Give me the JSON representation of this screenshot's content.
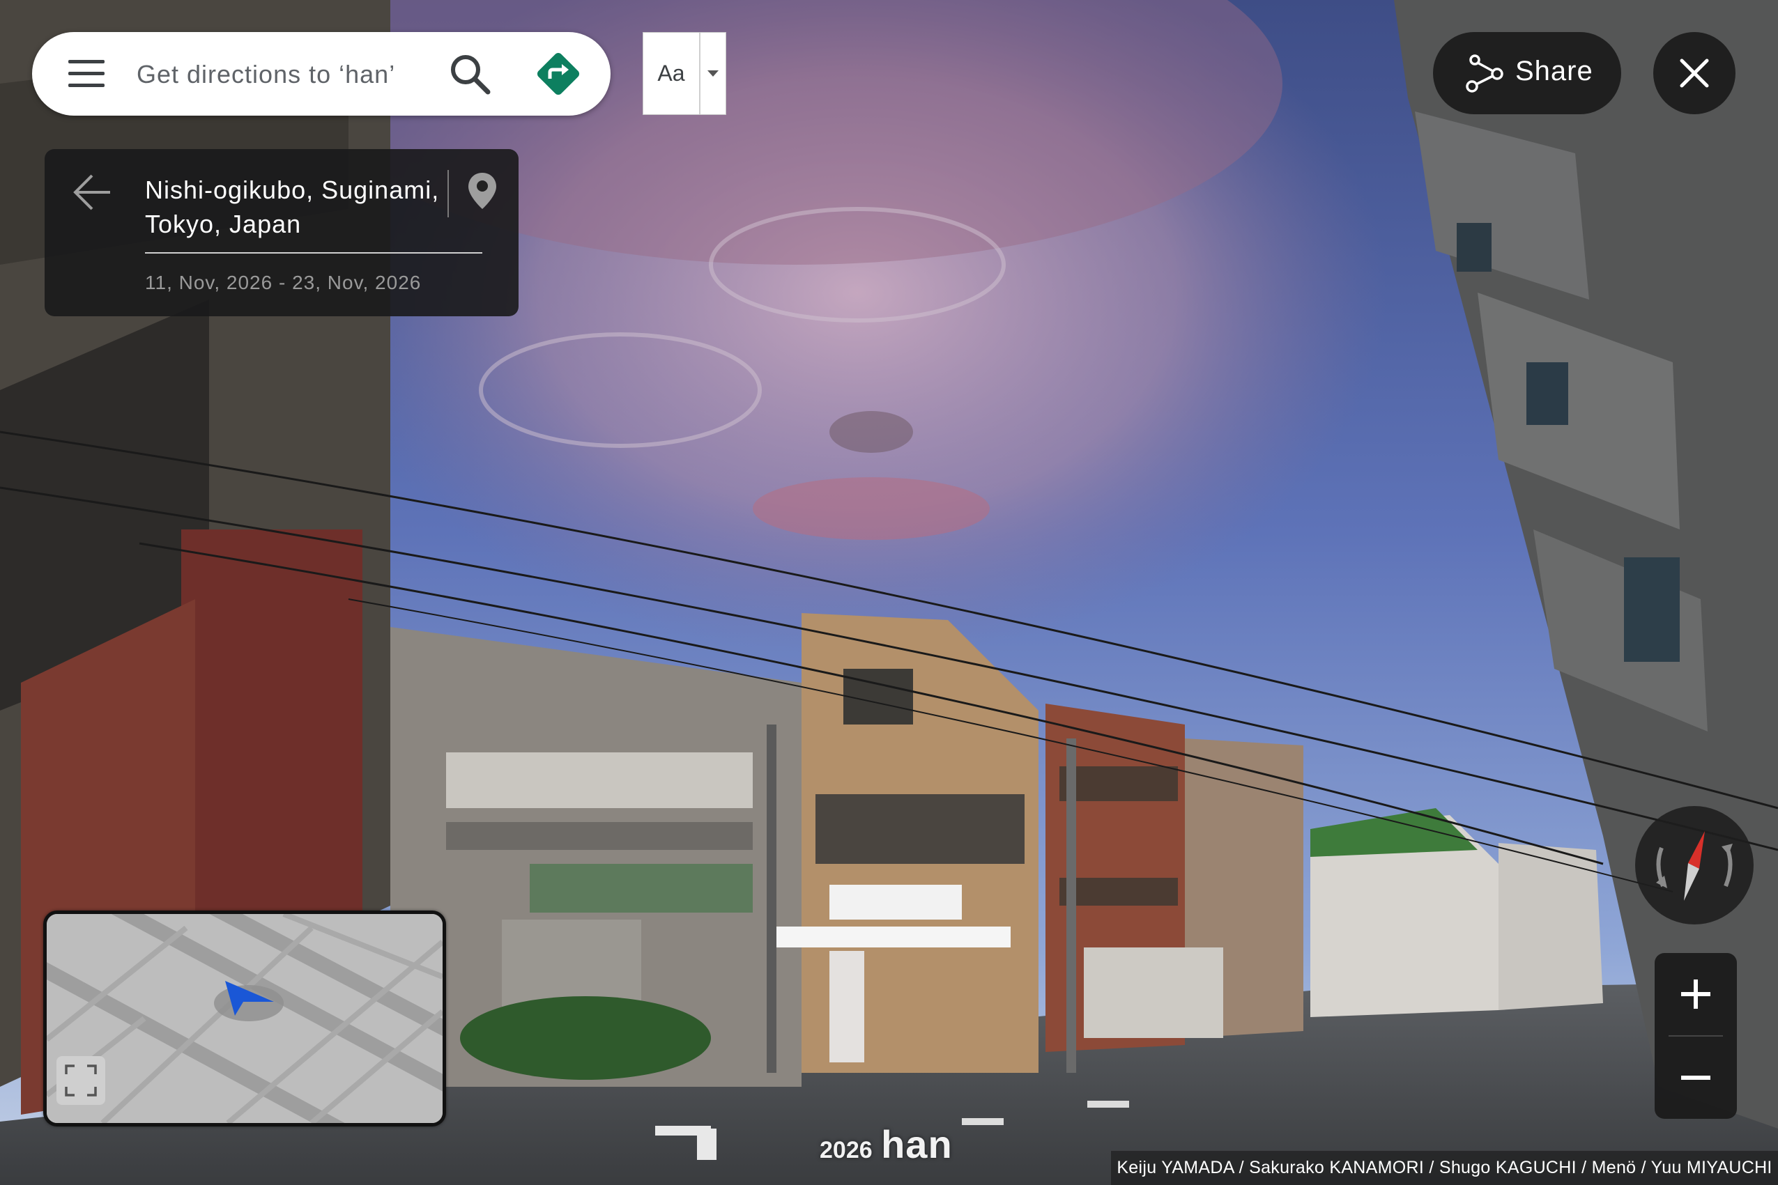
{
  "search": {
    "placeholder": "Get directions to ‘han’"
  },
  "font_toggle": {
    "label": "Aa"
  },
  "share": {
    "label": "Share"
  },
  "location_card": {
    "place": "Nishi-ogikubo, Suginami, Tokyo, Japan",
    "dates": "11, Nov, 2026 - 23, Nov, 2026"
  },
  "watermark": {
    "year": "2026",
    "name": "han"
  },
  "credits": "Keiju YAMADA / Sakurako KANAMORI / Shugo KAGUCHI / Menö / Yuu MIYAUCHI",
  "icons": {
    "menu": "menu-icon",
    "search": "search-icon",
    "directions": "directions-icon",
    "share": "share-icon",
    "close": "close-icon",
    "back": "back-arrow-icon",
    "pin": "location-pin-icon",
    "expand": "expand-icon",
    "compass": "compass-icon",
    "zoom_in": "plus-icon",
    "zoom_out": "minus-icon",
    "position_arrow": "position-arrow-icon"
  },
  "colors": {
    "directions_green": "#0d7f5f",
    "position_blue": "#1a57d6",
    "compass_red": "#d8302a"
  }
}
